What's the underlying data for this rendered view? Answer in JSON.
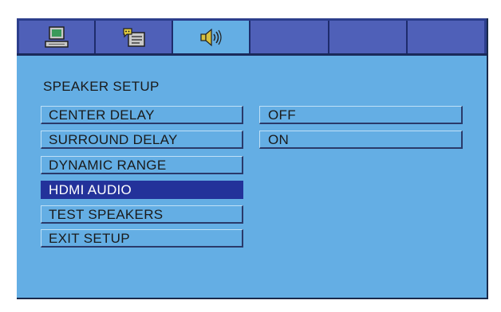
{
  "tabs": [
    {
      "icon": "monitor-icon",
      "active": false
    },
    {
      "icon": "language-icon",
      "active": false
    },
    {
      "icon": "speaker-icon",
      "active": true
    },
    {
      "icon": "",
      "active": false
    },
    {
      "icon": "",
      "active": false
    },
    {
      "icon": "",
      "active": false
    }
  ],
  "page_title": "SPEAKER SETUP",
  "menu_items": [
    {
      "label": "CENTER DELAY",
      "selected": false
    },
    {
      "label": "SURROUND DELAY",
      "selected": false
    },
    {
      "label": "DYNAMIC RANGE",
      "selected": false
    },
    {
      "label": "HDMI AUDIO",
      "selected": true
    },
    {
      "label": "TEST SPEAKERS",
      "selected": false
    },
    {
      "label": "EXIT SETUP",
      "selected": false
    }
  ],
  "options": [
    {
      "label": "OFF"
    },
    {
      "label": "ON"
    }
  ],
  "colors": {
    "background": "#64aee4",
    "tab_bar": "#2c3e8c",
    "tab": "#4f60b8",
    "selected": "#23329a"
  }
}
